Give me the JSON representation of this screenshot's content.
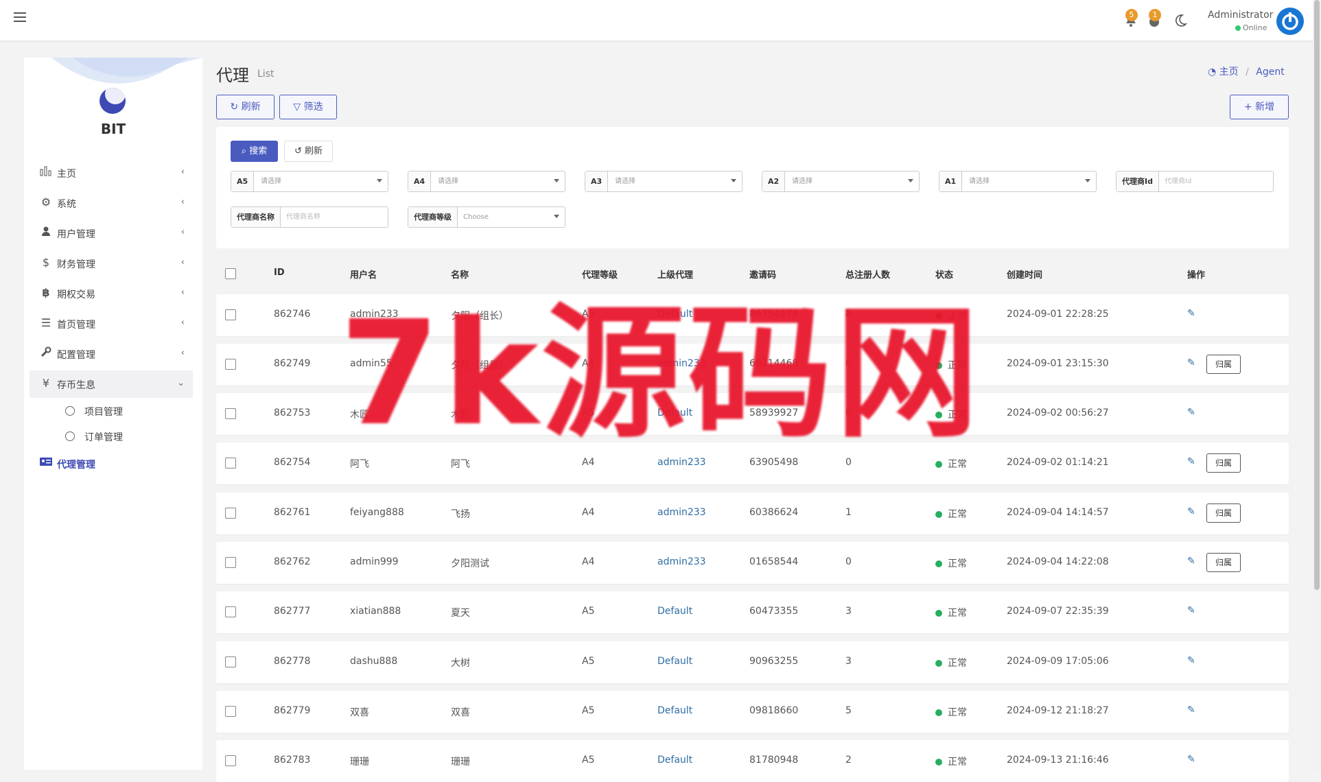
{
  "topbar": {
    "notif1_count": "5",
    "notif2_count": "1",
    "user_name": "Administrator",
    "user_status": "Online"
  },
  "sidebar": {
    "brand": "BIT",
    "items": [
      {
        "label": "主页",
        "icon": "chart-icon"
      },
      {
        "label": "系统",
        "icon": "gear-icon"
      },
      {
        "label": "用户管理",
        "icon": "user-icon"
      },
      {
        "label": "财务管理",
        "icon": "dollar-icon"
      },
      {
        "label": "期权交易",
        "icon": "bitcoin-icon"
      },
      {
        "label": "首页管理",
        "icon": "list-icon"
      },
      {
        "label": "配置管理",
        "icon": "wrench-icon"
      },
      {
        "label": "存币生息",
        "icon": "yen-icon"
      }
    ],
    "sub_items": [
      "项目管理",
      "订单管理"
    ],
    "active_item": "代理管理"
  },
  "page": {
    "title": "代理",
    "subtitle": "List",
    "breadcrumb_home": "主页",
    "breadcrumb_current": "Agent",
    "refresh_label": "刷新",
    "filter_label": "筛选",
    "add_label": "新增"
  },
  "filters": {
    "search_label": "搜索",
    "reset_label": "刷新",
    "selects": [
      {
        "label": "A5",
        "value": "请选择"
      },
      {
        "label": "A4",
        "value": "请选择"
      },
      {
        "label": "A3",
        "value": "请选择"
      },
      {
        "label": "A2",
        "value": "请选择"
      },
      {
        "label": "A1",
        "value": "请选择"
      }
    ],
    "agent_id_label": "代理商Id",
    "agent_id_placeholder": "代理商Id",
    "agent_name_label": "代理商名称",
    "agent_name_placeholder": "代理商名称",
    "agent_level_label": "代理商等级",
    "agent_level_value": "Choose"
  },
  "table": {
    "headers": [
      "ID",
      "用户名",
      "名称",
      "代理等级",
      "上级代理",
      "邀请码",
      "总注册人数",
      "状态",
      "创建时间",
      "操作"
    ],
    "belong_label": "归属",
    "rows": [
      {
        "id": "862746",
        "username": "admin233",
        "name": "夕阳（组长）",
        "level": "A5",
        "parent": "Default",
        "code": "86754278",
        "count": "8",
        "status": "正常",
        "created": "2024-09-01 22:28:25",
        "belong": false
      },
      {
        "id": "862749",
        "username": "admin55",
        "name": "夕阳（组员）",
        "level": "A4",
        "parent": "admin233",
        "code": "60714468",
        "count": "0",
        "status": "正常",
        "created": "2024-09-01 23:15:30",
        "belong": true
      },
      {
        "id": "862753",
        "username": "木匠",
        "name": "木匠",
        "level": "A5",
        "parent": "Default",
        "code": "58939927",
        "count": "0",
        "status": "正常",
        "created": "2024-09-02 00:56:27",
        "belong": false
      },
      {
        "id": "862754",
        "username": "阿飞",
        "name": "阿飞",
        "level": "A4",
        "parent": "admin233",
        "code": "63905498",
        "count": "0",
        "status": "正常",
        "created": "2024-09-02 01:14:21",
        "belong": true
      },
      {
        "id": "862761",
        "username": "feiyang888",
        "name": "飞扬",
        "level": "A4",
        "parent": "admin233",
        "code": "60386624",
        "count": "1",
        "status": "正常",
        "created": "2024-09-04 14:14:57",
        "belong": true
      },
      {
        "id": "862762",
        "username": "admin999",
        "name": "夕阳测试",
        "level": "A4",
        "parent": "admin233",
        "code": "01658544",
        "count": "0",
        "status": "正常",
        "created": "2024-09-04 14:22:08",
        "belong": true
      },
      {
        "id": "862777",
        "username": "xiatian888",
        "name": "夏天",
        "level": "A5",
        "parent": "Default",
        "code": "60473355",
        "count": "3",
        "status": "正常",
        "created": "2024-09-07 22:35:39",
        "belong": false
      },
      {
        "id": "862778",
        "username": "dashu888",
        "name": "大树",
        "level": "A5",
        "parent": "Default",
        "code": "90963255",
        "count": "3",
        "status": "正常",
        "created": "2024-09-09 17:05:06",
        "belong": false
      },
      {
        "id": "862779",
        "username": "双喜",
        "name": "双喜",
        "level": "A5",
        "parent": "Default",
        "code": "09818660",
        "count": "5",
        "status": "正常",
        "created": "2024-09-12 21:18:27",
        "belong": false
      },
      {
        "id": "862783",
        "username": "珊珊",
        "name": "珊珊",
        "level": "A5",
        "parent": "Default",
        "code": "81780948",
        "count": "2",
        "status": "正常",
        "created": "2024-09-13 21:16:46",
        "belong": false
      }
    ]
  },
  "watermark": "7k源码网"
}
